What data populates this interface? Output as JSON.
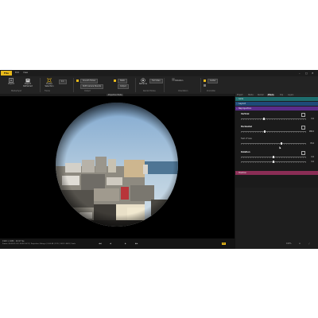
{
  "colors": {
    "accent": "#e8b91a",
    "section_teal": "#1e6e6e",
    "section_blue": "#1e4a78",
    "section_purple": "#5b2d8a",
    "section_pink": "#8a2d55"
  },
  "ribbon": {
    "file_tab": "File",
    "tabs": [
      "Edit",
      "View"
    ],
    "window_controls": [
      "–",
      "□",
      "✕"
    ],
    "buttons": [
      {
        "label": "Import",
        "icon": "import-icon"
      },
      {
        "label": "Export Reframed",
        "icon": "export-icon"
      },
      {
        "label": "Frame Selection",
        "icon": "frame-selection-icon"
      },
      {
        "label": "Reframe",
        "icon": "reframe-icon"
      },
      {
        "label": "Rotation",
        "icon": "rotation-icon"
      }
    ],
    "group_labels": [
      "Media/Input",
      "Frame",
      "Output",
      "Render Modes",
      "Orientation",
      "Zoom/Pan"
    ],
    "pills": [
      "Smooth Follow",
      "1:1",
      "Shift Camera Bounds",
      "Static",
      "Output",
      "Full Video",
      "Center"
    ],
    "mode_label": "Projection Mode"
  },
  "viewer": {
    "bottom_left_line1": "1920 x 1080 · 29.97 fps",
    "bottom_left_line2": "Frame: 00:00:21:03 / 00:02:14:11 | Projection: Fisheye | 0:00:38 | 12% | 1001 / 4033 | Scale",
    "playback": [
      "◀◀",
      "◀",
      "▶",
      "▶▶"
    ],
    "speed_badge": "1x",
    "right_controls": [
      "100%",
      "⚙",
      "⤢"
    ]
  },
  "panel": {
    "tabs": [
      "Project",
      "Media",
      "Render",
      "Effects",
      "Clip",
      "Layers"
    ],
    "active_tab": "Effects",
    "sections": [
      {
        "label": "Lens"
      },
      {
        "label": "Layout"
      },
      {
        "label": "Reprojection"
      }
    ],
    "vertical": {
      "title": "Vertical",
      "value": "0.0"
    },
    "horizontal": {
      "title": "Horizontal",
      "value": "180.0"
    },
    "subsection_label": "Field of View",
    "fov_value": "70.0",
    "rotation": {
      "title": "Rotation",
      "value1": "0.0",
      "value2": "0.0"
    },
    "last_section": "Position"
  }
}
